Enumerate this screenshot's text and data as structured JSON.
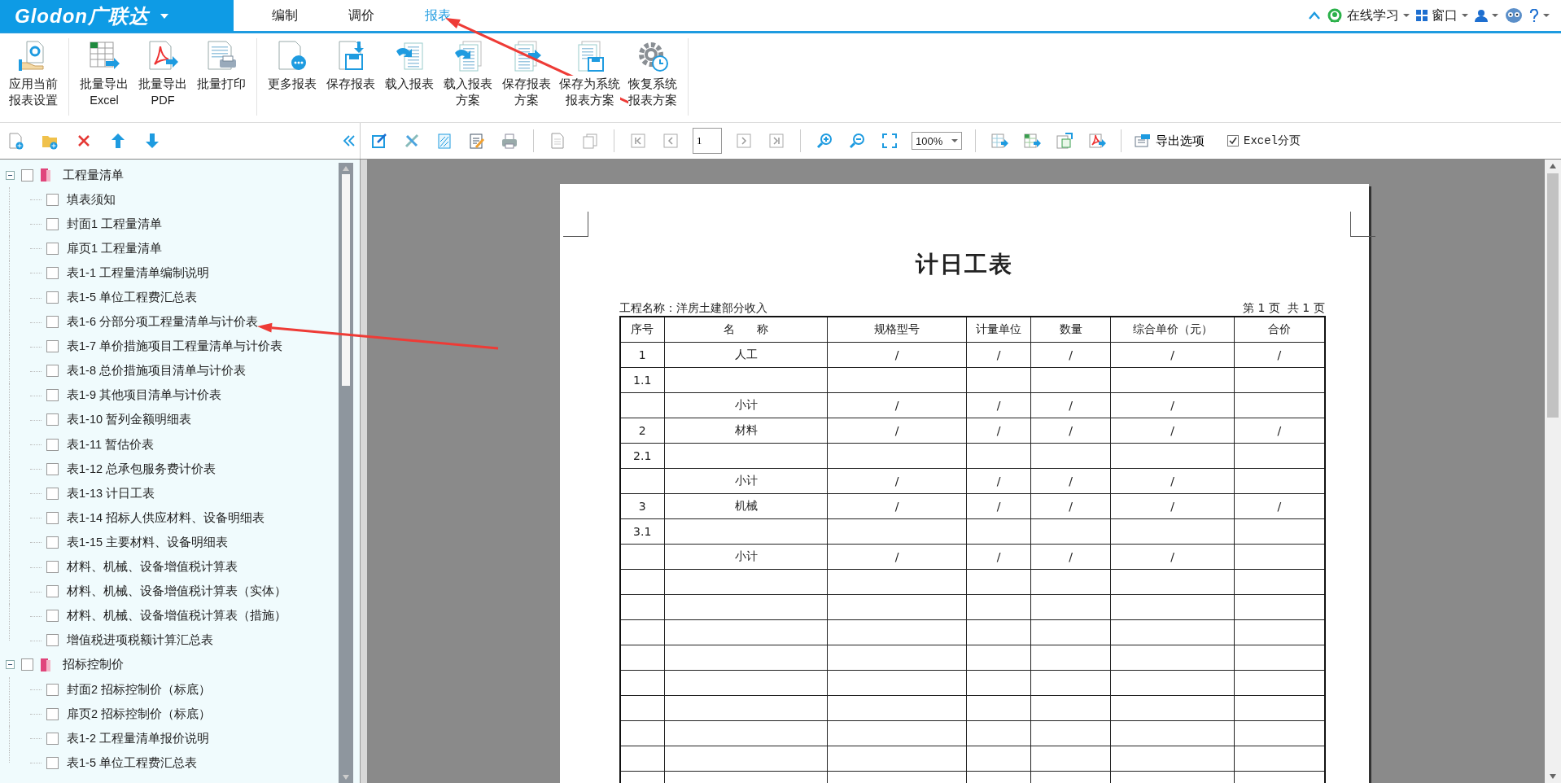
{
  "app": {
    "logo": "Glodon广联达"
  },
  "menu_tabs": [
    {
      "label": "编制",
      "selected": false
    },
    {
      "label": "调价",
      "selected": false
    },
    {
      "label": "报表",
      "selected": true
    }
  ],
  "top_right": {
    "learning": "在线学习",
    "window": "窗口"
  },
  "ribbon": [
    {
      "lines": [
        "应用当前",
        "报表设置"
      ]
    },
    {
      "lines": [
        "批量导出",
        "Excel"
      ]
    },
    {
      "lines": [
        "批量导出",
        "PDF"
      ]
    },
    {
      "lines": [
        "批量打印"
      ]
    },
    {
      "lines": [
        "更多报表"
      ]
    },
    {
      "lines": [
        "保存报表"
      ]
    },
    {
      "lines": [
        "载入报表"
      ]
    },
    {
      "lines": [
        "载入报表",
        "方案"
      ]
    },
    {
      "lines": [
        "保存报表",
        "方案"
      ]
    },
    {
      "lines": [
        "保存为系统",
        "报表方案"
      ]
    },
    {
      "lines": [
        "恢复系统",
        "报表方案"
      ]
    }
  ],
  "preview_toolbar": {
    "page_value": "1",
    "zoom": "100%",
    "export_options": "导出选项",
    "excel_paging": {
      "label": "Excel分页",
      "checked": true
    }
  },
  "tree": [
    {
      "label": "工程量清单",
      "expanded": true,
      "checked": false,
      "children": [
        {
          "label": "填表须知",
          "checked": false
        },
        {
          "label": "封面1 工程量清单",
          "checked": false
        },
        {
          "label": "扉页1 工程量清单",
          "checked": false
        },
        {
          "label": "表1-1 工程量清单编制说明",
          "checked": false
        },
        {
          "label": "表1-5 单位工程费汇总表",
          "checked": false
        },
        {
          "label": "表1-6 分部分项工程量清单与计价表",
          "checked": false
        },
        {
          "label": "表1-7 单价措施项目工程量清单与计价表",
          "checked": false
        },
        {
          "label": "表1-8 总价措施项目清单与计价表",
          "checked": false
        },
        {
          "label": "表1-9 其他项目清单与计价表",
          "checked": false
        },
        {
          "label": "表1-10 暂列金额明细表",
          "checked": false
        },
        {
          "label": "表1-11 暂估价表",
          "checked": false
        },
        {
          "label": "表1-12 总承包服务费计价表",
          "checked": false
        },
        {
          "label": "表1-13 计日工表",
          "checked": false
        },
        {
          "label": "表1-14 招标人供应材料、设备明细表",
          "checked": false
        },
        {
          "label": "表1-15 主要材料、设备明细表",
          "checked": false
        },
        {
          "label": "材料、机械、设备增值税计算表",
          "checked": false
        },
        {
          "label": "材料、机械、设备增值税计算表（实体）",
          "checked": false
        },
        {
          "label": "材料、机械、设备增值税计算表（措施）",
          "checked": false
        },
        {
          "label": "增值税进项税额计算汇总表",
          "checked": false
        }
      ]
    },
    {
      "label": "招标控制价",
      "expanded": true,
      "checked": false,
      "children": [
        {
          "label": "封面2 招标控制价（标底）",
          "checked": false
        },
        {
          "label": "扉页2 招标控制价（标底）",
          "checked": false
        },
        {
          "label": "表1-2 工程量清单报价说明",
          "checked": false
        },
        {
          "label": "表1-5 单位工程费汇总表",
          "checked": false
        }
      ]
    }
  ],
  "report": {
    "title": "计日工表",
    "project": "工程名称：洋房土建部分收入",
    "page_info": "第 1 页  共 1 页",
    "columns": [
      "序号",
      "名      称",
      "规格型号",
      "计量单位",
      "数量",
      "综合单价（元）",
      "合价"
    ],
    "rows": [
      [
        "1",
        "人工",
        "/",
        "/",
        "/",
        "/",
        "/"
      ],
      [
        "1.1",
        null,
        null,
        null,
        null,
        null,
        null
      ],
      [
        null,
        "小计",
        "/",
        "/",
        "/",
        "/",
        null
      ],
      [
        "2",
        "材料",
        "/",
        "/",
        "/",
        "/",
        "/"
      ],
      [
        "2.1",
        null,
        null,
        null,
        null,
        null,
        null
      ],
      [
        null,
        "小计",
        "/",
        "/",
        "/",
        "/",
        null
      ],
      [
        "3",
        "机械",
        "/",
        "/",
        "/",
        "/",
        "/"
      ],
      [
        "3.1",
        null,
        null,
        null,
        null,
        null,
        null
      ],
      [
        null,
        "小计",
        "/",
        "/",
        "/",
        "/",
        null
      ]
    ]
  }
}
